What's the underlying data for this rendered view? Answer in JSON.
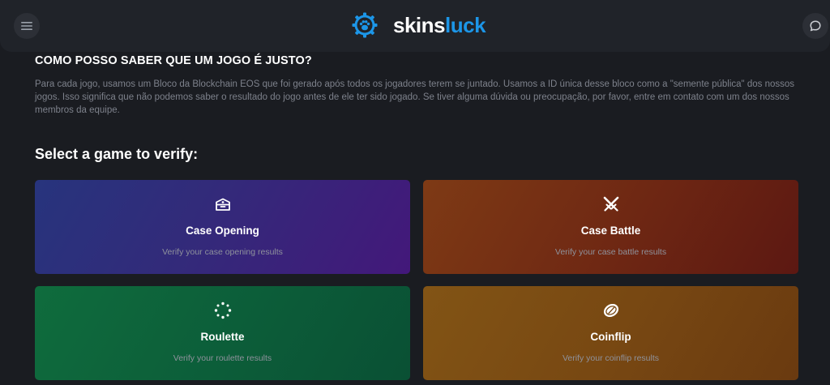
{
  "header": {
    "menu_icon": "hamburger-menu-icon",
    "logo_icon": "paw-gear-icon",
    "logo_text_white": "skins",
    "logo_text_blue": "luck",
    "chat_icon": "chat-bubble-icon",
    "colors": {
      "accent": "#1c96e8",
      "bar": "#202329",
      "page": "#1a1c21"
    }
  },
  "faq": {
    "title": "COMO POSSO SABER QUE UM JOGO É JUSTO?",
    "body": "Para cada jogo, usamos um Bloco da Blockchain EOS que foi gerado após todos os jogadores terem se juntado. Usamos a ID única desse bloco como a \"semente pública\" dos nossos jogos. Isso significa que não podemos saber o resultado do jogo antes de ele ter sido jogado. Se tiver alguma dúvida ou preocupação, por favor, entre em contato com um dos nossos membros da equipe."
  },
  "verify": {
    "title": "Select a game to verify:",
    "games": [
      {
        "title": "Case Opening",
        "subtitle": "Verify your case opening results",
        "icon": "case-crate-icon"
      },
      {
        "title": "Case Battle",
        "subtitle": "Verify your case battle results",
        "icon": "crossed-swords-icon"
      },
      {
        "title": "Roulette",
        "subtitle": "Verify your roulette results",
        "icon": "roulette-dots-icon"
      },
      {
        "title": "Coinflip",
        "subtitle": "Verify your coinflip results",
        "icon": "coin-icon"
      }
    ]
  }
}
